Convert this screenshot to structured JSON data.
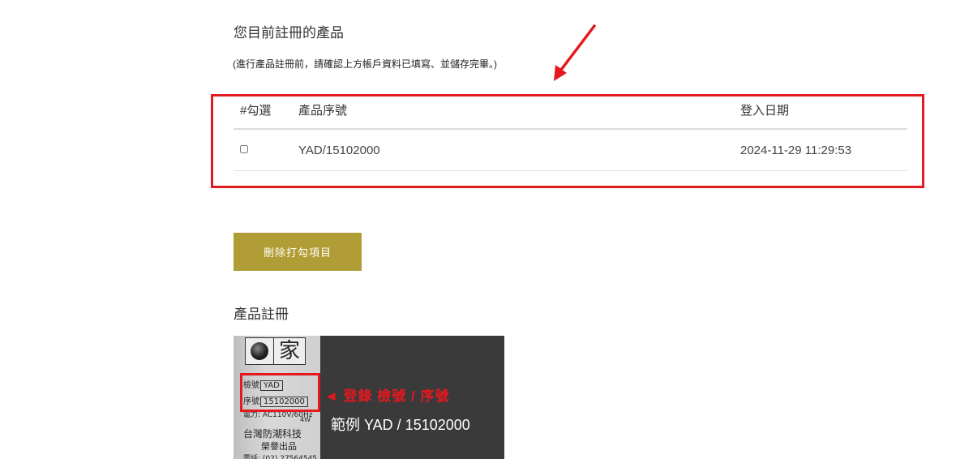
{
  "registered": {
    "title": "您目前註冊的產品",
    "note": "(進行產品註冊前，請確認上方帳戶資料已填寫、並儲存完畢。)"
  },
  "table": {
    "headers": {
      "check": "#勾選",
      "serial": "產品序號",
      "date": "登入日期"
    },
    "rows": [
      {
        "serial": "YAD/15102000",
        "date": "2024-11-29 11:29:53",
        "checked": false
      }
    ]
  },
  "actions": {
    "delete_label": "刪除打勾項目"
  },
  "registration": {
    "title": "產品註冊"
  },
  "example_image": {
    "logo_char": "家",
    "inspection_label": "檢號",
    "inspection_value": "YAD",
    "serial_label": "序號",
    "serial_value": "15102000",
    "power": "電力: AC110V/60Hz",
    "watt": "4W",
    "company": "台灣防潮科技",
    "honor": "榮譽出品",
    "phone": "電話: (02) 27564545",
    "callout": "◄ 登錄 檢號 / 序號",
    "example": "範例 YAD / 15102000"
  },
  "colors": {
    "highlight": "#e3191f",
    "button": "#b19d35",
    "button_text": "#ffffff"
  }
}
